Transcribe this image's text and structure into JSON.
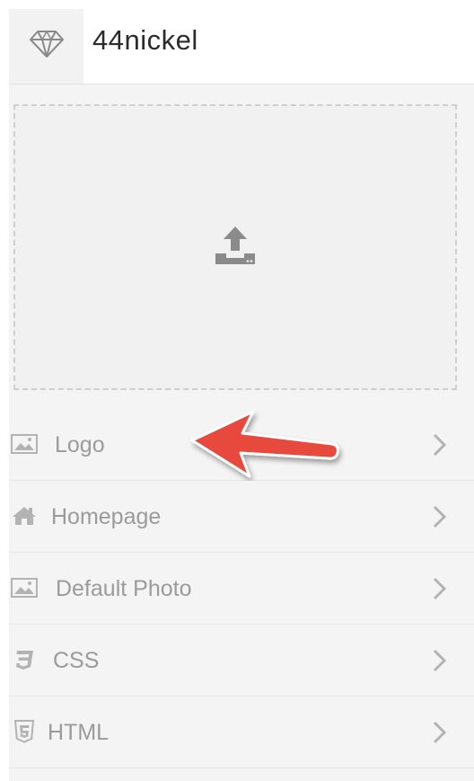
{
  "app": {
    "title": "44nickel",
    "logo_icon": "diamond-icon"
  },
  "upload": {
    "icon": "upload-icon"
  },
  "menu": {
    "items": [
      {
        "label": "Logo",
        "icon": "image-icon"
      },
      {
        "label": "Homepage",
        "icon": "home-icon"
      },
      {
        "label": "Default Photo",
        "icon": "image-icon"
      },
      {
        "label": "CSS",
        "icon": "css3-icon"
      },
      {
        "label": "HTML",
        "icon": "html5-icon"
      }
    ]
  },
  "annotation": {
    "icon": "red-arrow-icon",
    "color": "#e8493d"
  },
  "colors": {
    "panel_bg": "#f4f4f4",
    "text_muted": "#9b9b9b",
    "title_text": "#2b2b2b"
  }
}
